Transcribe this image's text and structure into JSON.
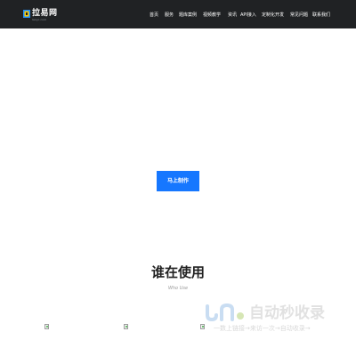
{
  "header": {
    "logo_name": "拉易网",
    "logo_sub": "lanyi.com",
    "nav": [
      {
        "label": "首页"
      },
      {
        "label": "服务"
      },
      {
        "label": "题库案例"
      },
      {
        "label": "视频教学"
      },
      {
        "label": "资讯"
      },
      {
        "label": "API接入"
      },
      {
        "label": "定制化开发"
      },
      {
        "label": "常见问题"
      },
      {
        "label": "联系我们"
      }
    ]
  },
  "hero": {
    "cta_label": "马上制作"
  },
  "who_use": {
    "title": "谁在使用",
    "subtitle": "Who Use"
  },
  "watermark": {
    "main": "自动秒收录",
    "sub": "一数上链接→来访一次→自动收录→"
  },
  "colors": {
    "header_bg": "#202224",
    "cta_bg": "#1677ff"
  }
}
